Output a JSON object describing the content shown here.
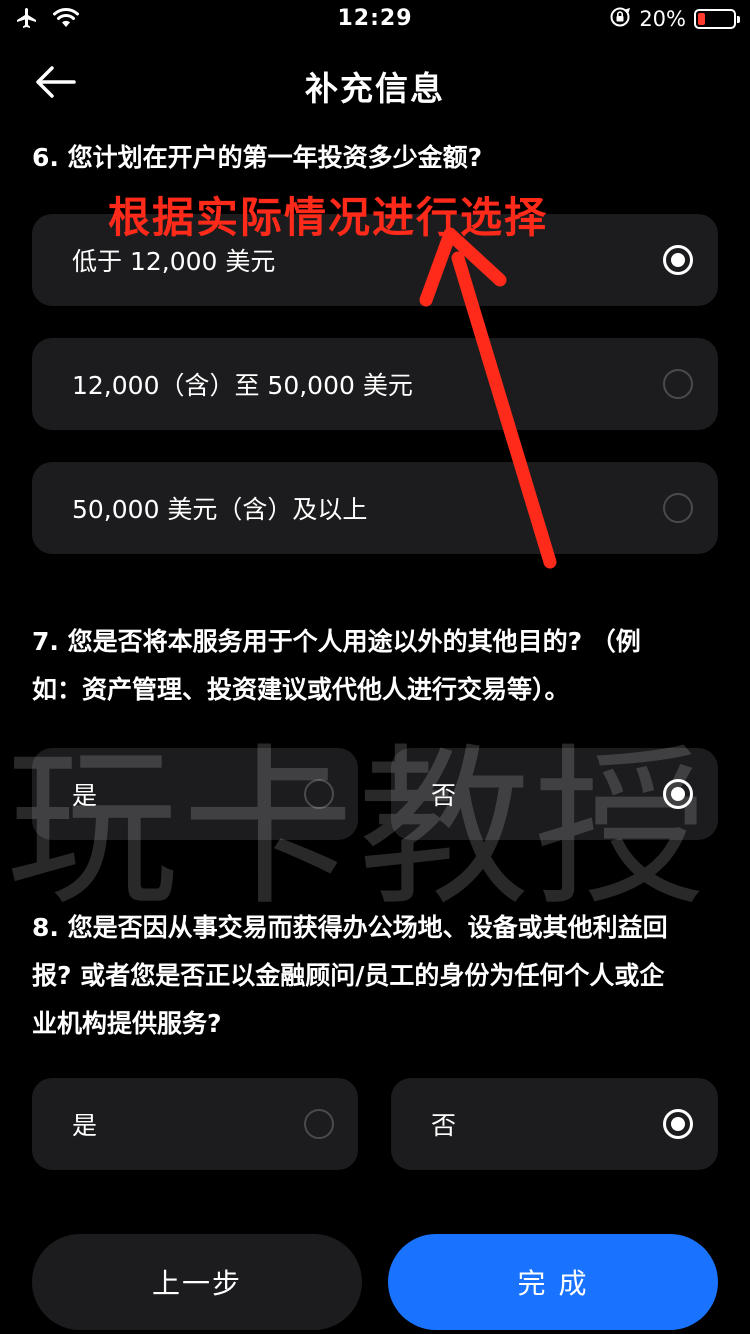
{
  "status_bar": {
    "time": "12:29",
    "battery_text": "20%",
    "battery_level": 0.2,
    "icons": [
      "airplane-icon",
      "wifi-icon",
      "rotation-lock-icon",
      "battery-icon"
    ]
  },
  "nav": {
    "title": "补充信息",
    "back_icon": "arrow-left-icon"
  },
  "annotation": {
    "text": "根据实际情况进行选择",
    "color": "#ff2a1a"
  },
  "watermark": "玩卡教授",
  "questions": {
    "q6": {
      "title": "6. 您计划在开户的第一年投资多少金额?",
      "options": [
        {
          "label": "低于 12,000 美元",
          "selected": true
        },
        {
          "label": "12,000（含）至 50,000 美元",
          "selected": false
        },
        {
          "label": "50,000 美元（含）及以上",
          "selected": false
        }
      ]
    },
    "q7": {
      "title_line1": "7. 您是否将本服务用于个人用途以外的其他目的? （例",
      "title_line2": "如：资产管理、投资建议或代他人进行交易等）。",
      "options": [
        {
          "label": "是",
          "selected": false
        },
        {
          "label": "否",
          "selected": true
        }
      ]
    },
    "q8": {
      "title_line1": "8. 您是否因从事交易而获得办公场地、设备或其他利益回",
      "title_line2": "报? 或者您是否正以金融顾问/员工的身份为任何个人或企",
      "title_line3": "业机构提供服务?",
      "options": [
        {
          "label": "是",
          "selected": false
        },
        {
          "label": "否",
          "selected": true
        }
      ]
    }
  },
  "footer": {
    "prev_label": "上一步",
    "finish_label": "完 成"
  },
  "colors": {
    "background": "#000000",
    "card": "#1c1c1e",
    "primary": "#1a73ff",
    "battery_low": "#ff3b30"
  }
}
